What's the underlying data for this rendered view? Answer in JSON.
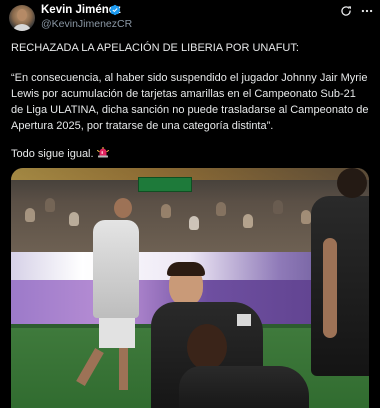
{
  "author": {
    "display_name": "Kevin Jiménez",
    "handle": "@KevinJimenezCR"
  },
  "tweet": {
    "headline": "RECHAZADA LA APELACIÓN DE LIBERIA POR UNAFUT:",
    "quote": "“En consecuencia, al haber sido suspendido el jugador Johnny Jair Myrie Lewis por acumulación de tarjetas amarillas en el Campeonato Sub-21 de Liga ULATINA, dicha sanción no puede trasladarse al Campeonato de Apertura 2025, por tratarse de una categoría distinta”.",
    "closing": "Todo sigue igual."
  },
  "icons": {
    "verified": "verified-badge-icon",
    "refresh": "refresh-icon",
    "more": "more-options-icon",
    "emoji": "siren-icon"
  },
  "colors": {
    "background": "#000000",
    "text": "#e7e9ea",
    "secondary_text": "#8b98a5",
    "verified_blue": "#1d9bf0",
    "siren_red": "#e0245e"
  }
}
